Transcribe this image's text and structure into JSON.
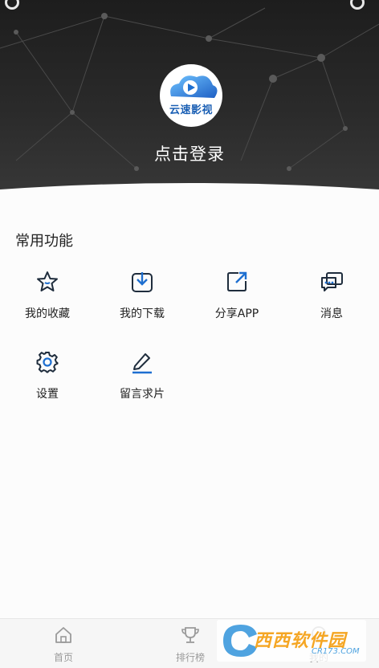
{
  "profile": {
    "app_logo_text": "云速影视",
    "login_prompt": "点击登录"
  },
  "functions": {
    "title": "常用功能",
    "items": [
      {
        "label": "我的收藏",
        "icon": "star-icon"
      },
      {
        "label": "我的下载",
        "icon": "download-icon"
      },
      {
        "label": "分享APP",
        "icon": "share-icon"
      },
      {
        "label": "消息",
        "icon": "message-icon"
      },
      {
        "label": "设置",
        "icon": "gear-icon"
      },
      {
        "label": "留言求片",
        "icon": "pen-icon"
      }
    ]
  },
  "tabbar": {
    "items": [
      {
        "label": "首页",
        "icon": "home-icon"
      },
      {
        "label": "排行榜",
        "icon": "trophy-icon"
      },
      {
        "label": "我的",
        "icon": "user-icon"
      }
    ]
  },
  "watermark": {
    "brand": "西西软件园",
    "site": "CR173.COM"
  },
  "colors": {
    "header_dark": "#1d1d1d",
    "accent_blue": "#1e6fd0",
    "icon_dark": "#1f2d3d"
  }
}
